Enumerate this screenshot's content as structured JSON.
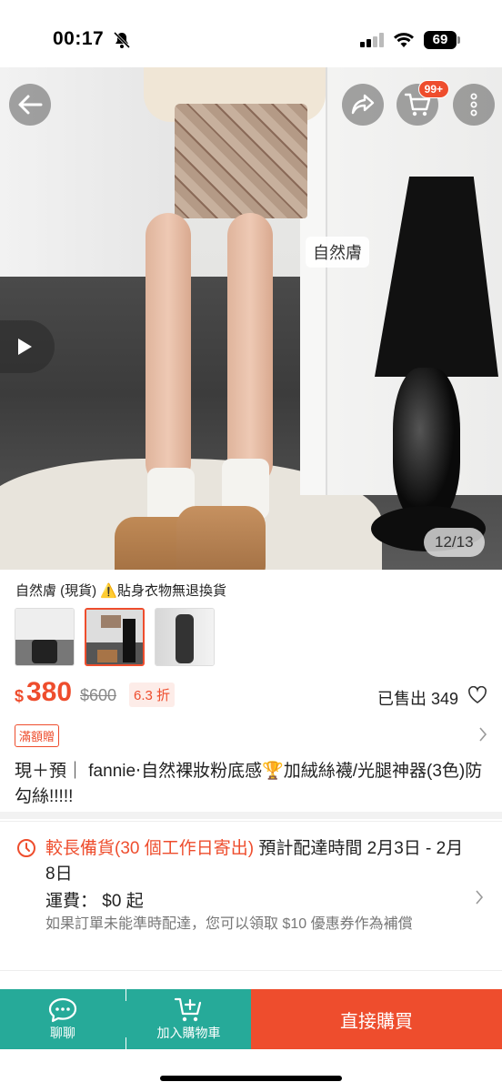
{
  "status_bar": {
    "time": "00:17",
    "battery": "69"
  },
  "hero": {
    "cart_badge": "99+",
    "overlay_label": "自然膚",
    "page_counter": "12/13"
  },
  "variant": {
    "name": "自然膚 (現貨) ⚠️貼身衣物無退換貨"
  },
  "price": {
    "currency": "$",
    "current": "380",
    "original": "$600",
    "discount": "6.3 折",
    "sold": "已售出 349"
  },
  "promo": {
    "tag": "滿額贈"
  },
  "product": {
    "title": "現＋預｜ fannie‧自然裸妝粉底感🏆加絨絲襪/光腿神器(3色)防勾絲!!!!!"
  },
  "shipping": {
    "highlight": "較長備貨(30 個工作日寄出)",
    "estimate": " 預計配達時間 2月3日 - 2月8日",
    "fee": "運費： $0 起",
    "note": "如果訂單未能準時配達，您可以領取 $10 優惠券作為補償"
  },
  "bottom_bar": {
    "chat_label": "聊聊",
    "cart_label": "加入購物車",
    "buy_label": "直接購買"
  },
  "colors": {
    "accent": "#ee4d2d",
    "teal": "#26aa99"
  },
  "icons": [
    "bell-off-icon",
    "signal-icon",
    "wifi-icon",
    "back-arrow-icon",
    "share-icon",
    "cart-icon",
    "more-icon",
    "play-icon",
    "heart-icon",
    "chevron-right-icon",
    "clock-icon",
    "chat-icon",
    "add-cart-icon"
  ]
}
